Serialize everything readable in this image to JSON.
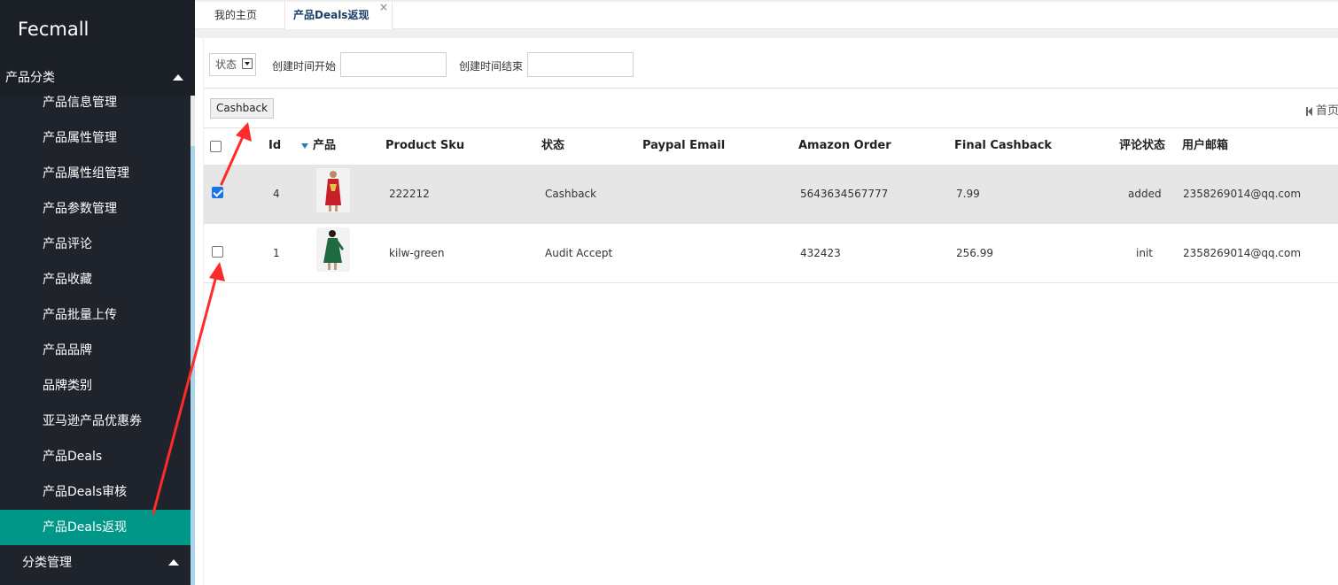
{
  "app": {
    "brand": "Fecmall"
  },
  "sidebar": {
    "section_title": "产品分类",
    "items": [
      "产品信息管理",
      "产品属性管理",
      "产品属性组管理",
      "产品参数管理",
      "产品评论",
      "产品收藏",
      "产品批量上传",
      "产品品牌",
      "品牌类别",
      "亚马逊产品优惠券",
      "产品Deals",
      "产品Deals审核",
      "产品Deals返现"
    ],
    "active_item": "产品Deals返现",
    "next_section": "分类管理"
  },
  "tabs": [
    {
      "label": "我的主页"
    },
    {
      "label": "产品Deals返现",
      "close": "×"
    }
  ],
  "filters": {
    "status_select": "状态",
    "created_start_label": "创建时间开始",
    "created_end_label": "创建时间结束"
  },
  "toolbar": {
    "cashback_button": "Cashback",
    "pager_first": "首页"
  },
  "table": {
    "columns": [
      "Id",
      "产品",
      "Product Sku",
      "状态",
      "Paypal Email",
      "Amazon Order",
      "Final Cashback",
      "评论状态",
      "用户邮箱"
    ],
    "rows": [
      {
        "checked": true,
        "id": "4",
        "sku": "222212",
        "status": "Cashback",
        "paypal_email": "",
        "amazon_order": "5643634567777",
        "final_cashback": "7.99",
        "review_status": "added",
        "user_email": "2358269014@qq.com"
      },
      {
        "checked": false,
        "id": "1",
        "sku": "kilw-green",
        "status": "Audit Accept",
        "paypal_email": "",
        "amazon_order": "432423",
        "final_cashback": "256.99",
        "review_status": "init",
        "user_email": "2358269014@qq.com"
      }
    ]
  },
  "colors": {
    "sidebar_bg": "#1f232b",
    "active_item_bg": "#009688",
    "annotation_arrow": "#ff2a2a",
    "selected_row_bg": "#e6e6e6"
  }
}
